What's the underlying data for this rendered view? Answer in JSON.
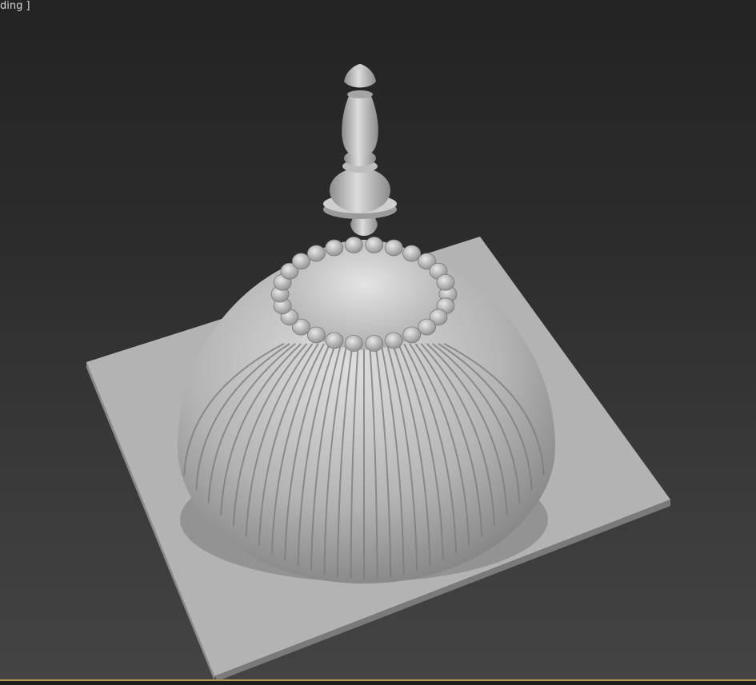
{
  "viewport": {
    "label": "ding ]",
    "scene_objects": [
      "ground-plane",
      "fluted-dome",
      "bead-ring",
      "finial-spire"
    ],
    "colors": {
      "background_top": "#232323",
      "background_bottom": "#444444",
      "model_light": "#d2d2d2",
      "model_mid": "#a8a8a8",
      "model_dark": "#6e6e6e",
      "active_border": "#b39a55"
    }
  }
}
